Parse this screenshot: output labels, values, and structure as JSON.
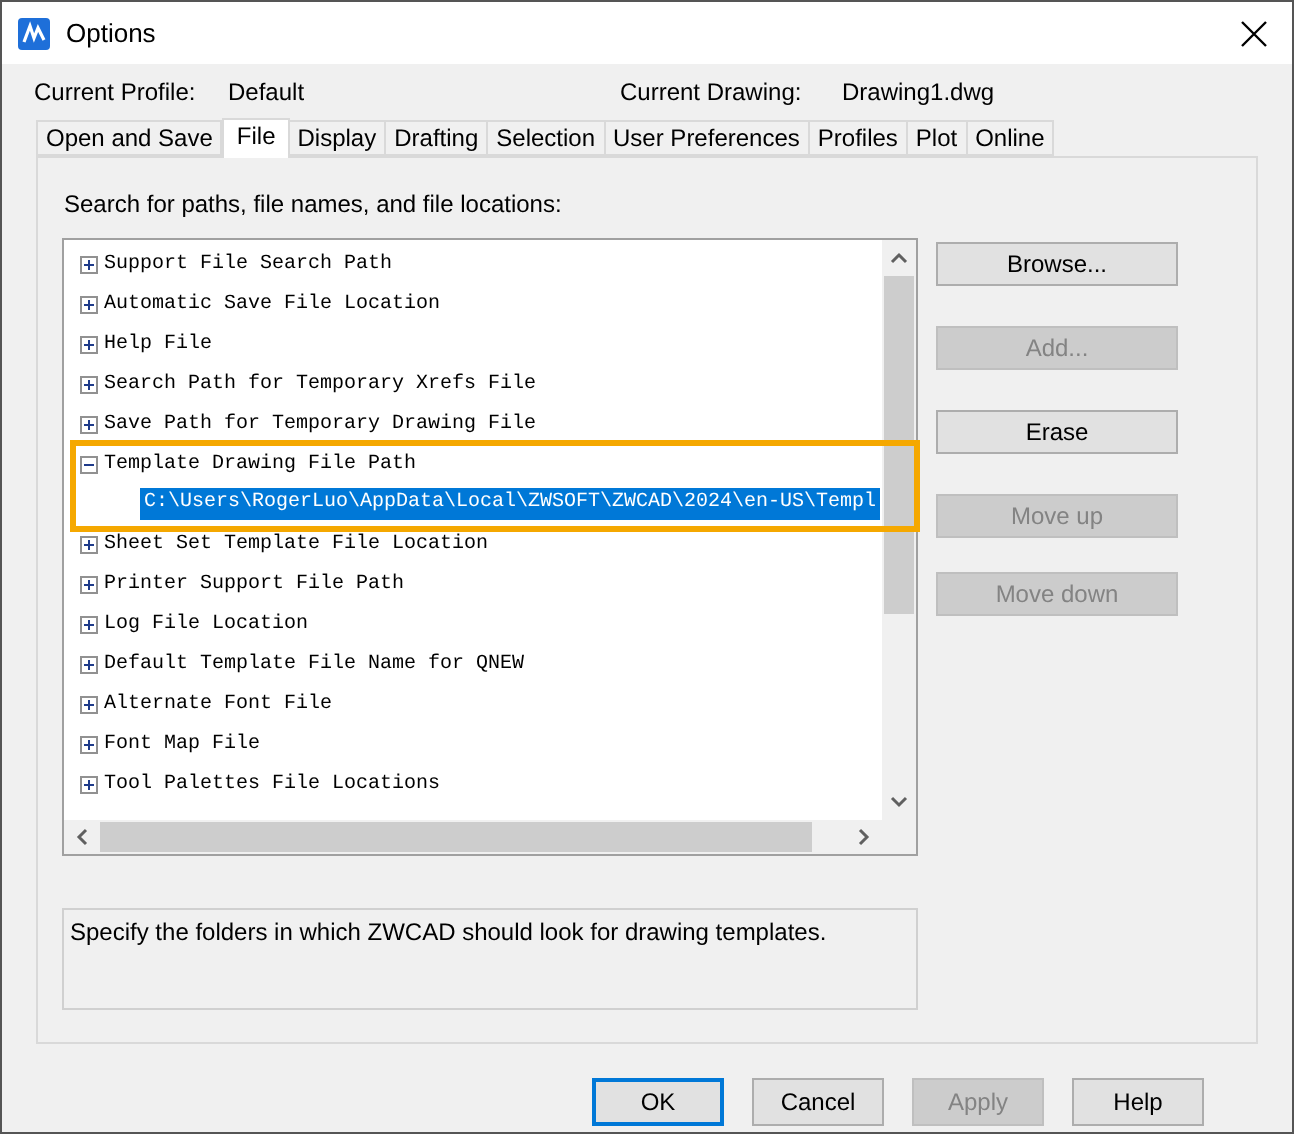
{
  "window": {
    "title": "Options"
  },
  "profile": {
    "label": "Current Profile:",
    "value": "Default"
  },
  "drawing": {
    "label": "Current Drawing:",
    "value": "Drawing1.dwg"
  },
  "tabs": [
    {
      "label": "Open and Save",
      "selected": false
    },
    {
      "label": "File",
      "selected": true
    },
    {
      "label": "Display",
      "selected": false
    },
    {
      "label": "Drafting",
      "selected": false
    },
    {
      "label": "Selection",
      "selected": false
    },
    {
      "label": "User Preferences",
      "selected": false
    },
    {
      "label": "Profiles",
      "selected": false
    },
    {
      "label": "Plot",
      "selected": false
    },
    {
      "label": "Online",
      "selected": false
    }
  ],
  "tree_heading": "Search for paths, file names, and file locations:",
  "tree": [
    {
      "label": "Support File Search Path",
      "expanded": false
    },
    {
      "label": "Automatic Save File Location",
      "expanded": false
    },
    {
      "label": "Help File",
      "expanded": false
    },
    {
      "label": "Search Path for Temporary Xrefs File",
      "expanded": false
    },
    {
      "label": "Save Path for Temporary Drawing File",
      "expanded": false
    },
    {
      "label": "Template Drawing File Path",
      "expanded": true,
      "highlighted": true,
      "children": [
        {
          "label": "C:\\Users\\RogerLuo\\AppData\\Local\\ZWSOFT\\ZWCAD\\2024\\en-US\\Templ",
          "selected": true
        }
      ]
    },
    {
      "label": "Sheet Set Template File Location",
      "expanded": false
    },
    {
      "label": "Printer Support File Path",
      "expanded": false
    },
    {
      "label": "Log File Location",
      "expanded": false
    },
    {
      "label": "Default Template File Name for QNEW",
      "expanded": false
    },
    {
      "label": "Alternate Font File",
      "expanded": false
    },
    {
      "label": "Font Map File",
      "expanded": false
    },
    {
      "label": "Tool Palettes File Locations",
      "expanded": false
    }
  ],
  "side_buttons": [
    {
      "label": "Browse...",
      "disabled": false
    },
    {
      "label": "Add...",
      "disabled": true
    },
    {
      "label": "Erase",
      "disabled": false
    },
    {
      "label": "Move up",
      "disabled": true
    },
    {
      "label": "Move down",
      "disabled": true
    }
  ],
  "description": "Specify the folders in which ZWCAD should look for drawing templates.",
  "footer_buttons": [
    {
      "label": "OK",
      "disabled": false,
      "default": true
    },
    {
      "label": "Cancel",
      "disabled": false,
      "default": false
    },
    {
      "label": "Apply",
      "disabled": true,
      "default": false
    },
    {
      "label": "Help",
      "disabled": false,
      "default": false
    }
  ]
}
